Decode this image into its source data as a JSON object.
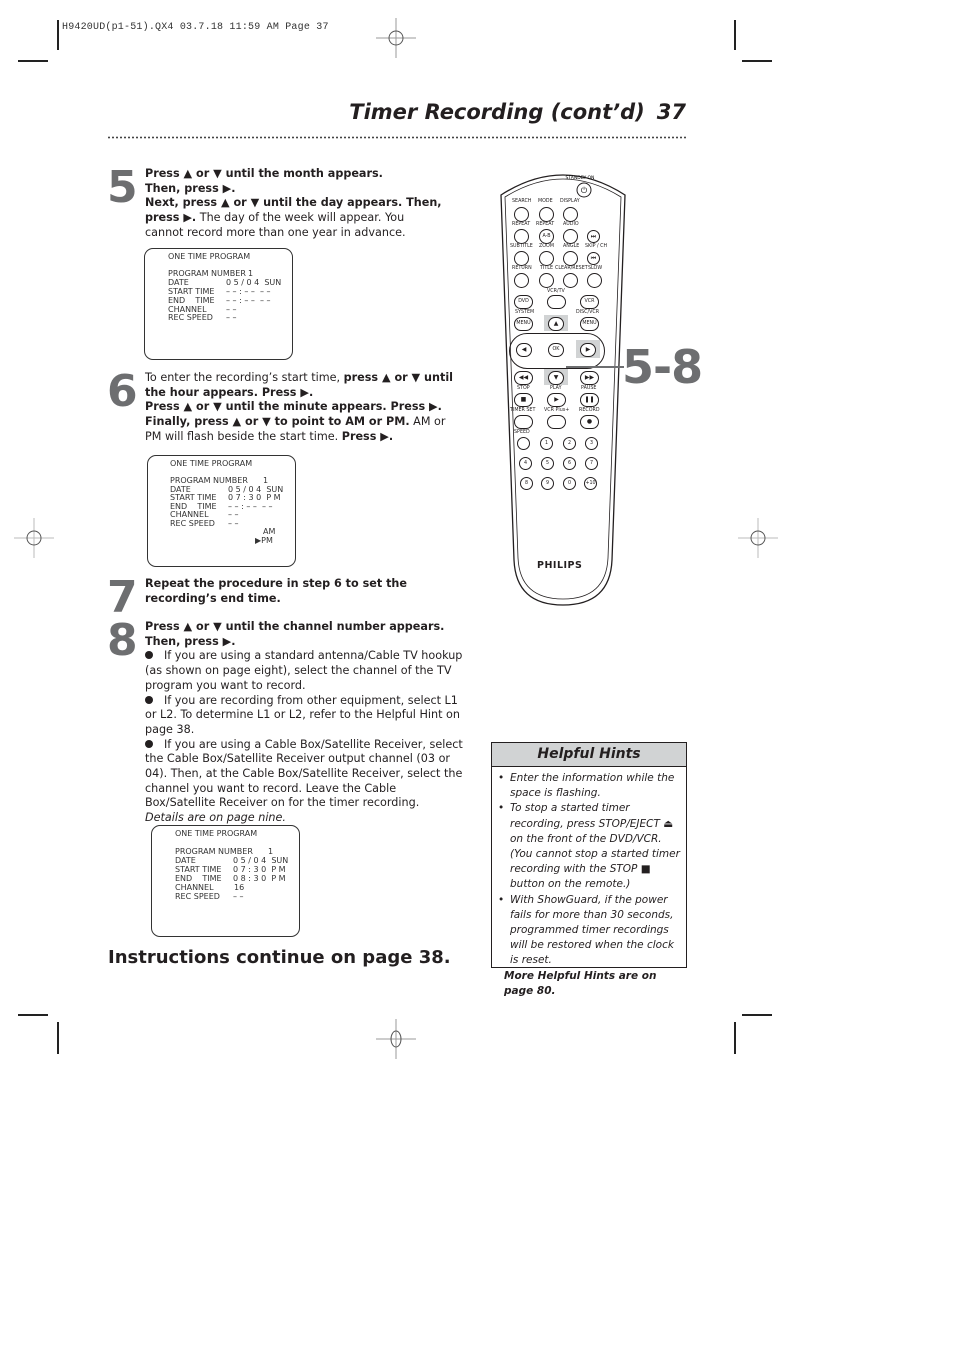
{
  "slug": "H9420UD(p1-51).QX4  03.7.18  11:59 AM  Page 37",
  "header": {
    "title": "Timer Recording (cont’d)",
    "page_number": "37"
  },
  "steps": [
    {
      "number": "5",
      "lines": [
        {
          "bold": "Press ▲ or ▼ until the month appears."
        },
        {
          "bold": "Then, press ▶."
        },
        {
          "bold": "Next, press ▲ or ▼ until the day appears. Then, press ▶.",
          "normal": " The day of the week will appear. You cannot record more than one year in advance."
        }
      ]
    },
    {
      "number": "6",
      "normal_intro": "To enter the recording’s start time, ",
      "bold_1": "press ▲ or ▼ until the hour appears. Press ▶.",
      "bold_2": "Press ▲ or ▼ until the minute appears. Press ▶.",
      "bold_3": "Finally, press ▲ or ▼ to point to AM or PM.",
      "normal_2": "  AM or PM will flash beside the start time. ",
      "bold_4": "Press ▶."
    },
    {
      "number": "7",
      "bold": "Repeat the procedure in step 6 to set the recording’s end time."
    },
    {
      "number": "8",
      "bold": "Press ▲ or ▼ until the channel number appears. Then, press ▶.",
      "bullets": [
        "If you are using a standard antenna/Cable TV hookup (as shown on page eight), select the channel of the TV program you want to record.",
        "If you are recording from other equipment, select L1 or L2. To determine L1 or L2, refer to the Helpful Hint on page 38.",
        "If you are using a Cable Box/Satellite Receiver, select the Cable Box/Satellite Receiver output channel (03 or 04). Then, at the Cable Box/Satellite Receiver, select the channel you want to record. Leave the Cable Box/Satellite Receiver on for the timer recording."
      ],
      "note": "Details are on page nine."
    }
  ],
  "osd_screens": [
    {
      "title": "ONE TIME PROGRAM",
      "rows": [
        {
          "label": "PROGRAM NUMBER",
          "value": "1"
        },
        {
          "label": "DATE",
          "value": "0 5 / 0 4  SUN"
        },
        {
          "label": "START TIME",
          "value": "– – : – –  – –"
        },
        {
          "label": "END    TIME",
          "value": "– – : – –  – –"
        },
        {
          "label": "CHANNEL",
          "value": "– –"
        },
        {
          "label": "REC SPEED",
          "value": "– –"
        }
      ]
    },
    {
      "title": "ONE TIME PROGRAM",
      "rows": [
        {
          "label": "PROGRAM NUMBER",
          "value": "1"
        },
        {
          "label": "DATE",
          "value": "0 5 / 0 4  SUN"
        },
        {
          "label": "START TIME",
          "value": "0 7 : 3 0  P M"
        },
        {
          "label": "END    TIME",
          "value": "– – : – –  – –"
        },
        {
          "label": "CHANNEL",
          "value": "– –"
        },
        {
          "label": "REC SPEED",
          "value": "– –"
        }
      ],
      "ampm_options": [
        "AM",
        "▶PM"
      ]
    },
    {
      "title": "ONE TIME PROGRAM",
      "rows": [
        {
          "label": "PROGRAM NUMBER",
          "value": "1"
        },
        {
          "label": "DATE",
          "value": "0 5 / 0 4  SUN"
        },
        {
          "label": "START TIME",
          "value": "0 7 : 3 0  P M"
        },
        {
          "label": "END    TIME",
          "value": "0 8 : 3 0  P M"
        },
        {
          "label": "CHANNEL",
          "value": "16"
        },
        {
          "label": "REC SPEED",
          "value": "– –"
        }
      ]
    }
  ],
  "continue_text": "Instructions continue on page 38.",
  "remote": {
    "brand": "PHILIPS",
    "callout": "5-8",
    "labels": {
      "standby": "STANDBY-ON",
      "row1": [
        "SEARCH",
        "MODE",
        "DISPLAY"
      ],
      "row2": [
        "REPEAT",
        "REPEAT",
        "AUDIO"
      ],
      "ab": "A-B",
      "row3": [
        "SUBTITLE",
        "ZOOM",
        "ANGLE",
        "SKIP / CH"
      ],
      "row4": [
        "RETURN",
        "TITLE",
        "CLEAR/RESET",
        "SLOW"
      ],
      "vcrtv": "VCR/TV",
      "dvd": "DVD",
      "vcr": "VCR",
      "system": "SYSTEM",
      "discvcr": "DISC/VCR",
      "menu": "MENU",
      "ok": "OK",
      "row5": [
        "STOP",
        "PLAY",
        "PAUSE"
      ],
      "row6": [
        "TIMER SET",
        "VCR Plus+",
        "RECORD"
      ],
      "speed": "SPEED",
      "digits": [
        "1",
        "2",
        "3",
        "4",
        "5",
        "6",
        "7",
        "8",
        "9",
        "0",
        "+10"
      ]
    }
  },
  "hints": {
    "title": "Helpful Hints",
    "items": [
      "Enter the information while the space is flashing.",
      "To stop a started timer recording, press STOP/EJECT ⏏ on the front of the DVD/VCR. (You cannot stop a started timer recording with the STOP ■ button on the remote.)",
      "With ShowGuard, if the power fails for more than 30 seconds, programmed timer recordings will be restored when the clock is reset."
    ],
    "more": "More Helpful Hints are on page 80."
  }
}
